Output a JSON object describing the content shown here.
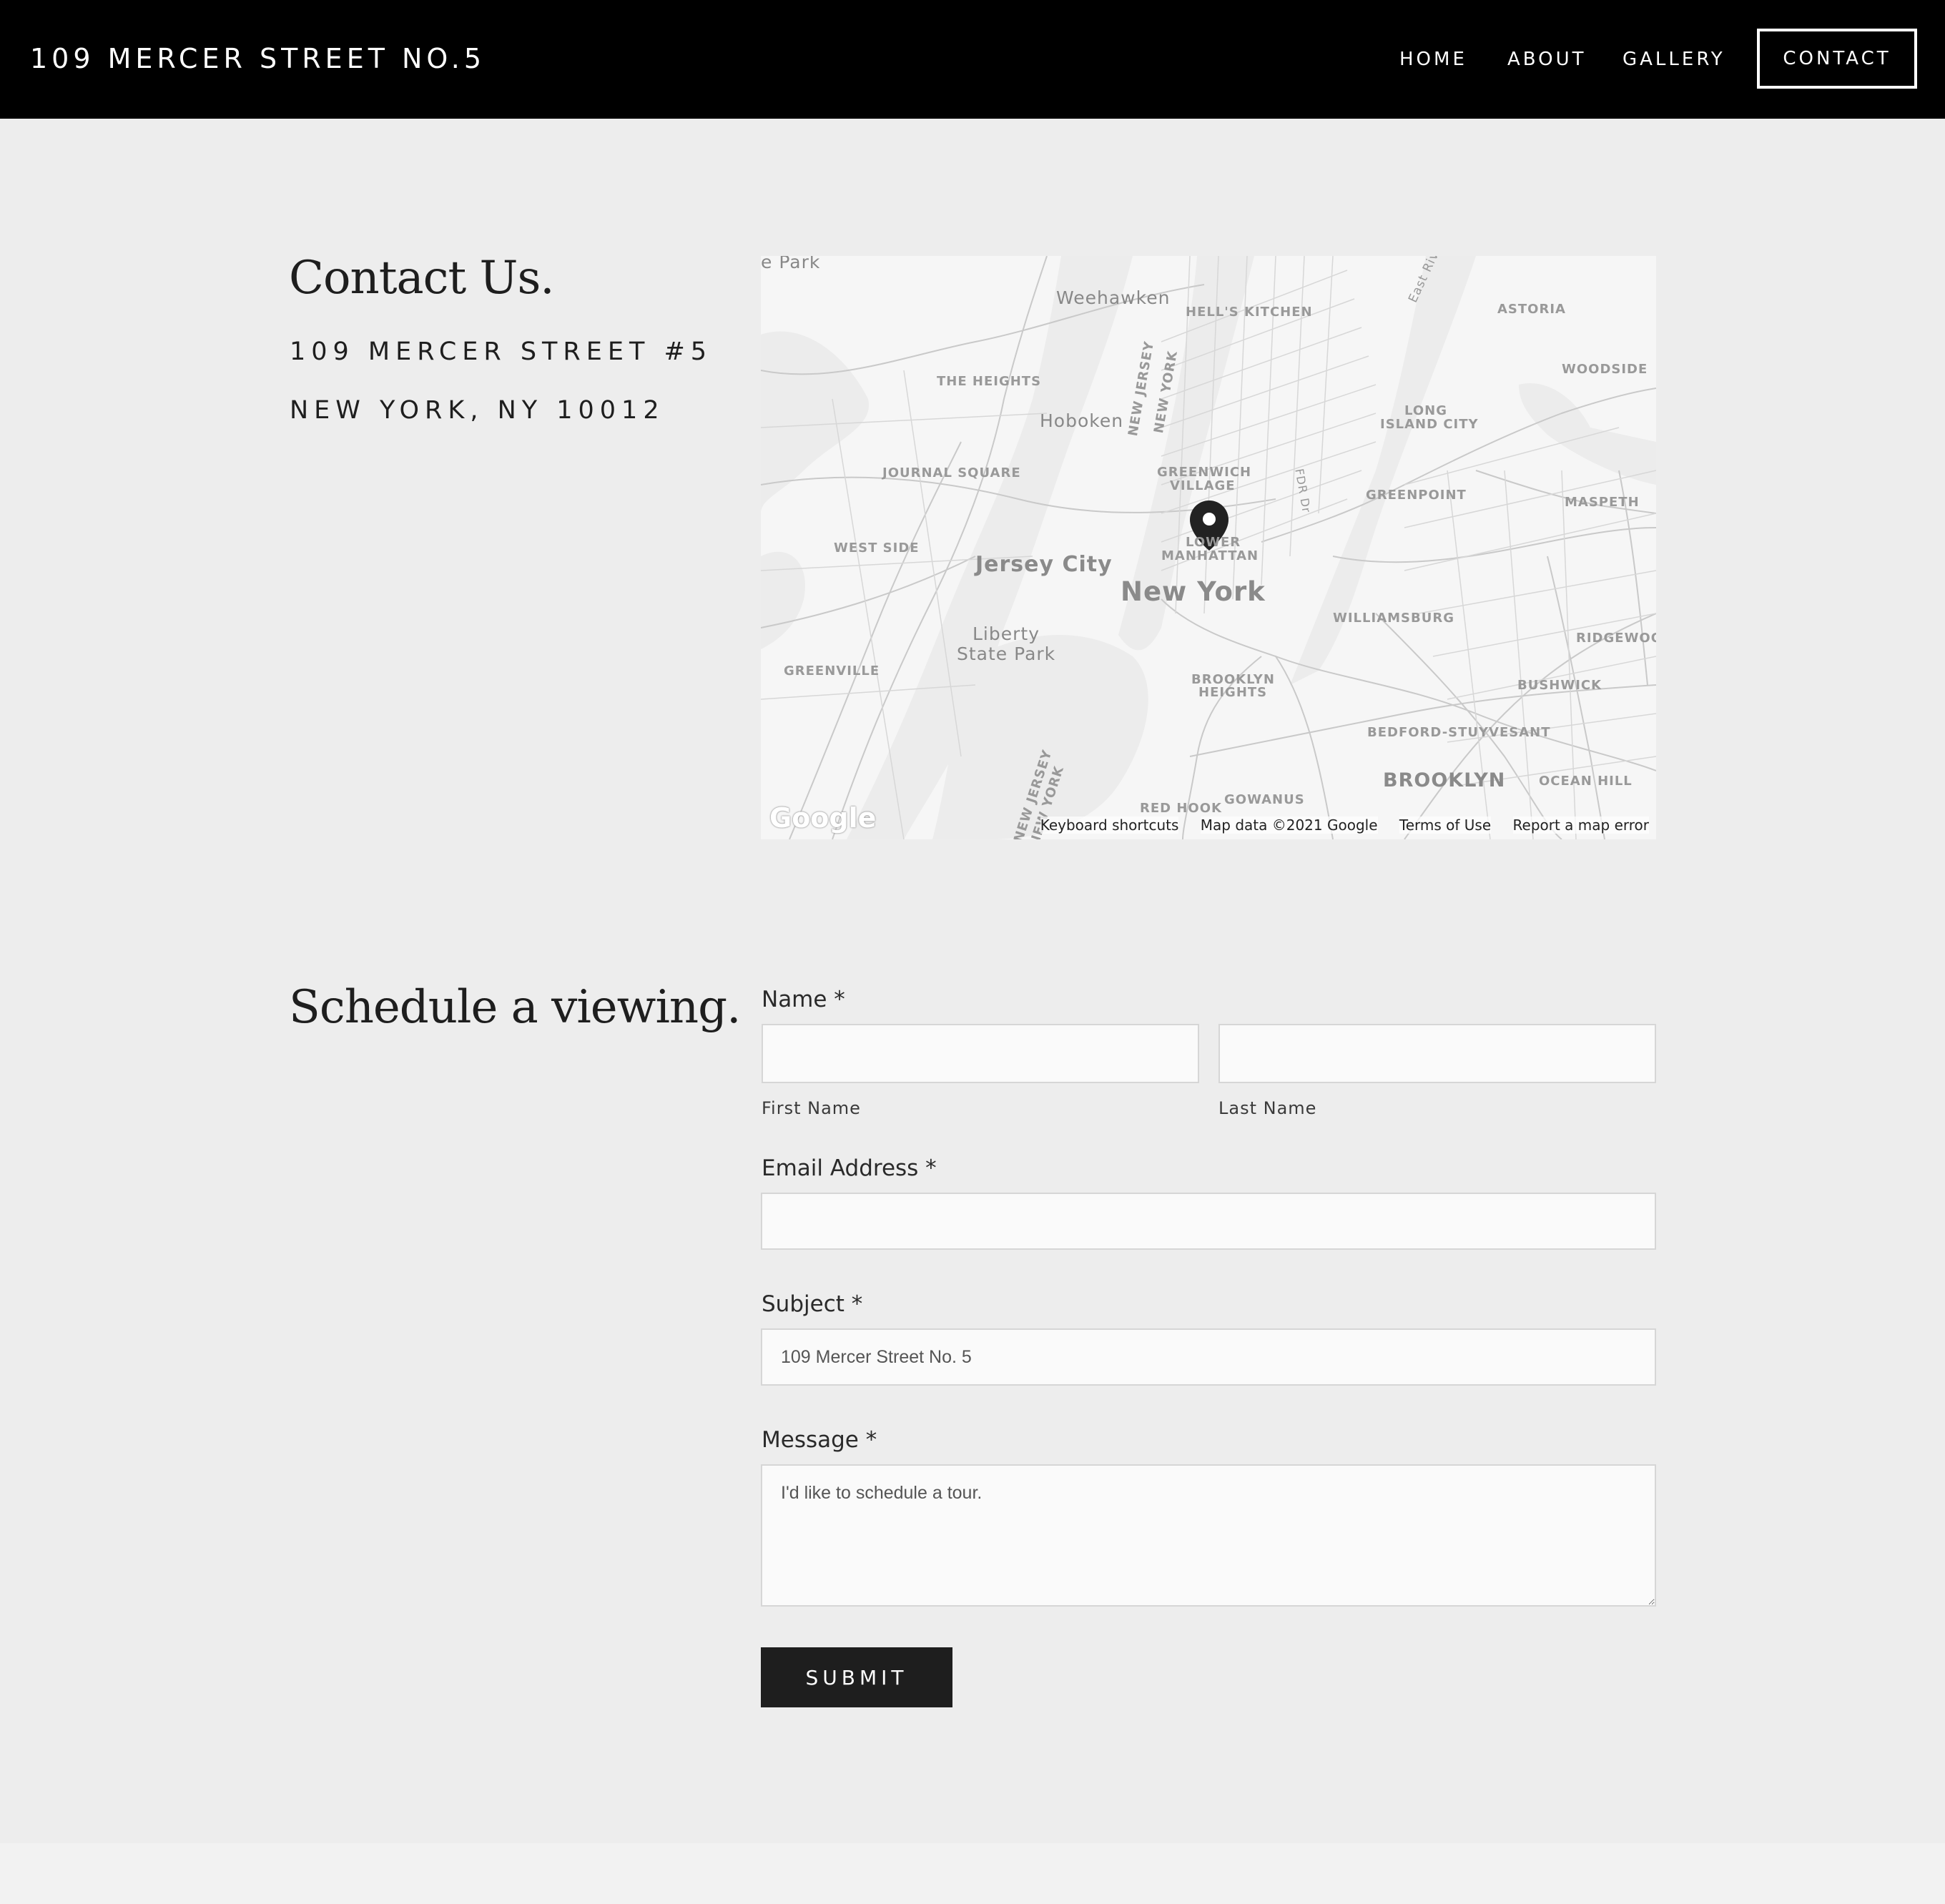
{
  "header": {
    "site_title": "109 MERCER STREET NO.5",
    "nav": {
      "home": "HOME",
      "about": "ABOUT",
      "gallery": "GALLERY",
      "contact": "CONTACT"
    }
  },
  "contact": {
    "heading": "Contact Us.",
    "address_line1": "109 MERCER STREET #5",
    "address_line2": "NEW YORK, NY 10012"
  },
  "map": {
    "labels": {
      "weehawken": "Weehawken",
      "hells_kitchen": "HELL'S KITCHEN",
      "astoria": "ASTORIA",
      "east_river": "East River",
      "the_heights": "THE HEIGHTS",
      "woodside": "WOODSIDE",
      "hoboken": "Hoboken",
      "new_jersey": "NEW JERSEY",
      "new_york_state": "NEW YORK",
      "lic_1": "LONG",
      "lic_2": "ISLAND CITY",
      "journal_square": "JOURNAL SQUARE",
      "gv_1": "GREENWICH",
      "gv_2": "VILLAGE",
      "fdr": "FDR Dr",
      "greenpoint": "GREENPOINT",
      "maspeth": "MASPETH",
      "lm_1": "LOWER",
      "lm_2": "MANHATTAN",
      "west_side": "WEST SIDE",
      "jersey_city": "Jersey City",
      "new_york": "New York",
      "williamsburg": "WILLIAMSBURG",
      "ridgewood": "RIDGEWOO",
      "lsp_1": "Liberty",
      "lsp_2": "State Park",
      "greenville": "GREENVILLE",
      "bh_1": "BROOKLYN",
      "bh_2": "HEIGHTS",
      "bushwick": "BUSHWICK",
      "bedstuy": "BEDFORD-STUYVESANT",
      "brooklyn": "BROOKLYN",
      "ocean_hill": "OCEAN HILL",
      "nj_2": "NEW JERSEY",
      "ny_2": "NEW YORK",
      "red_hook": "RED HOOK",
      "gowanus": "GOWANUS",
      "top_left": "e Park"
    },
    "google": "Google",
    "footer": {
      "shortcuts": "Keyboard shortcuts",
      "data": "Map data ©2021 Google",
      "terms": "Terms of Use",
      "report": "Report a map error"
    }
  },
  "form": {
    "heading": "Schedule a viewing.",
    "name_label": "Name *",
    "first_name_label": "First Name",
    "last_name_label": "Last Name",
    "first_name_value": "",
    "last_name_value": "",
    "email_label": "Email Address *",
    "email_value": "",
    "subject_label": "Subject *",
    "subject_value": "109 Mercer Street No. 5",
    "message_label": "Message *",
    "message_value": "I'd like to schedule a tour.",
    "submit_label": "SUBMIT"
  }
}
